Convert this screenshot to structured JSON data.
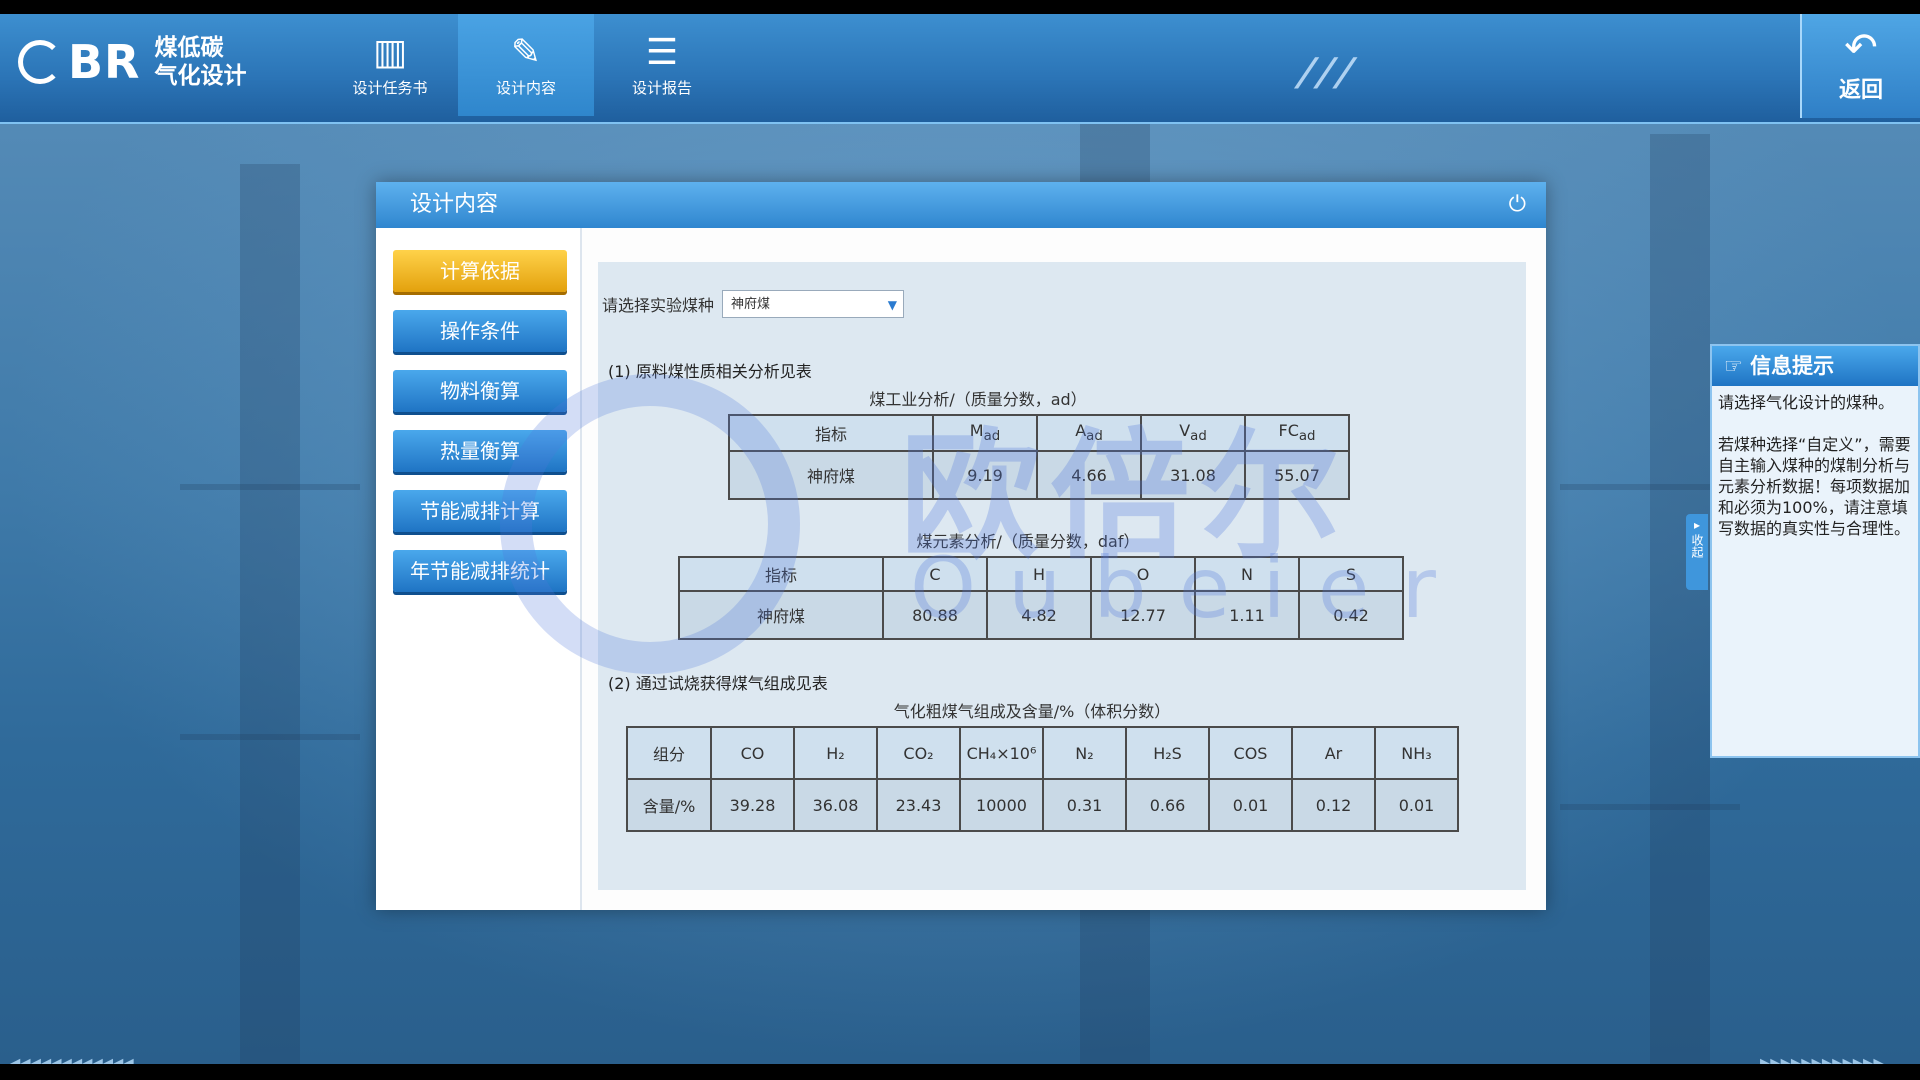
{
  "app": {
    "logo_text": "BR",
    "logo_cn_line1": "煤低碳",
    "logo_cn_line2": "气化设计",
    "back_label": "返回"
  },
  "nav": [
    {
      "label": "设计任务书",
      "icon": "books-icon"
    },
    {
      "label": "设计内容",
      "icon": "edit-icon"
    },
    {
      "label": "设计报告",
      "icon": "report-icon"
    }
  ],
  "dialog": {
    "title": "设计内容"
  },
  "sidebar": [
    {
      "label": "计算依据",
      "active": true
    },
    {
      "label": "操作条件"
    },
    {
      "label": "物料衡算"
    },
    {
      "label": "热量衡算"
    },
    {
      "label": "节能减排计算"
    },
    {
      "label": "年节能减排统计"
    }
  ],
  "select": {
    "label": "请选择实验煤种",
    "value": "神府煤"
  },
  "section1": {
    "title": "(1) 原料煤性质相关分析见表",
    "table1": {
      "caption": "煤工业分析/（质量分数，ad）",
      "headers": [
        "指标",
        "M",
        "A",
        "V",
        "FC"
      ],
      "sub": "ad",
      "row": [
        "神府煤",
        "9.19",
        "4.66",
        "31.08",
        "55.07"
      ]
    },
    "table2": {
      "caption": "煤元素分析/（质量分数，daf）",
      "headers": [
        "指标",
        "C",
        "H",
        "O",
        "N",
        "S"
      ],
      "row": [
        "神府煤",
        "80.88",
        "4.82",
        "12.77",
        "1.11",
        "0.42"
      ]
    }
  },
  "section2": {
    "title": "(2) 通过试烧获得煤气组成见表",
    "table3": {
      "caption": "气化粗煤气组成及含量/%（体积分数）",
      "headers": [
        "组分",
        "CO",
        "H₂",
        "CO₂",
        "CH₄×10⁶",
        "N₂",
        "H₂S",
        "COS",
        "Ar",
        "NH₃"
      ],
      "row": [
        "含量/%",
        "39.28",
        "36.08",
        "23.43",
        "10000",
        "0.31",
        "0.66",
        "0.01",
        "0.12",
        "0.01"
      ]
    }
  },
  "info": {
    "title": "信息提示",
    "line1": "请选择气化设计的煤种。",
    "line2": "若煤种选择“自定义”，需要自主输入煤种的煤制分析与元素分析数据！每项数据加和必须为100%，请注意填写数据的真实性与合理性。",
    "collapse_label": "收起"
  },
  "watermark": {
    "cn": "欧倍尔",
    "en": "Oubeier"
  }
}
